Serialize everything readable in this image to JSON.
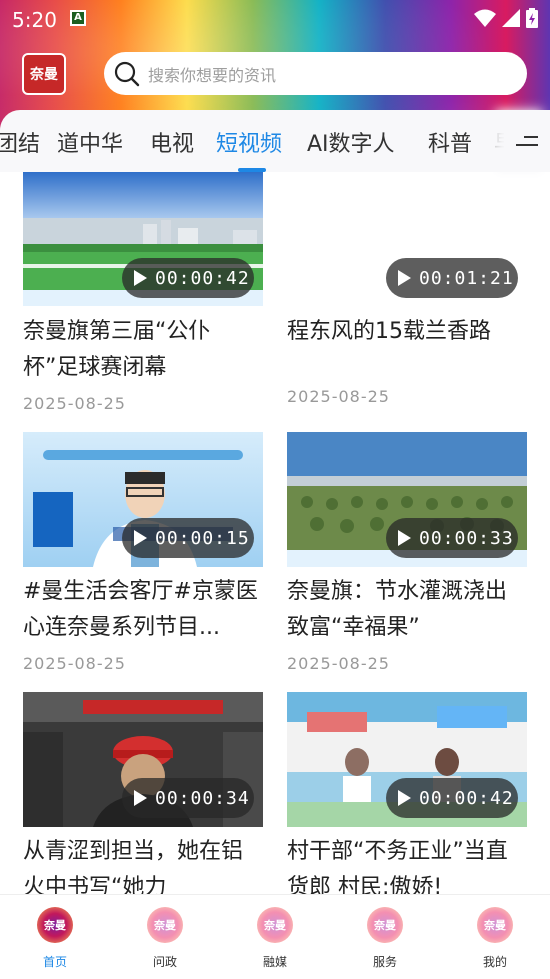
{
  "status_bar": {
    "time": "5:20",
    "notification_glyph": "A"
  },
  "header": {
    "logo_text": "奈曼",
    "search_placeholder": "搜索你想要的资讯"
  },
  "tabs": [
    {
      "label": "团结"
    },
    {
      "label": "道中华"
    },
    {
      "label": "电视"
    },
    {
      "label": "短视频",
      "active": true
    },
    {
      "label": "AI数字人"
    },
    {
      "label": "科普"
    },
    {
      "label": "早"
    }
  ],
  "videos": [
    {
      "title": "奈曼旗第三届“公仆杯”足球赛闭幕",
      "duration": "00:00:42",
      "date": "2025-08-25",
      "thumb_text": "奈曼旗第三届“公仆杯”足球赛闭幕"
    },
    {
      "title": "程东风的15载兰香路",
      "duration": "00:01:21",
      "date": "2025-08-25"
    },
    {
      "title": "#曼生活会客厅#京蒙医心连奈曼系列节目...",
      "duration": "00:00:15",
      "date": "2025-08-25",
      "thumb_text": "曼生活会客厅"
    },
    {
      "title": "奈曼旗：节水灌溉浇出致富“幸福果”",
      "duration": "00:00:33",
      "date": "2025-08-25",
      "thumb_text": "奈曼旗 节水灌溉浇出致富 “幸福果”"
    },
    {
      "title": "从青涩到担当，她在铝火中书写“她力",
      "duration": "00:00:34",
      "date": ""
    },
    {
      "title": "村干部“不务正业”当直货郎 村民:傲娇!",
      "duration": "00:00:42",
      "date": ""
    }
  ],
  "bottom_nav": [
    {
      "label": "首页",
      "active": true,
      "icon_text": "奈曼"
    },
    {
      "label": "问政",
      "icon_text": "奈曼"
    },
    {
      "label": "融媒",
      "icon_text": "奈曼"
    },
    {
      "label": "服务",
      "icon_text": "奈曼"
    },
    {
      "label": "我的",
      "icon_text": "奈曼"
    }
  ],
  "colors": {
    "accent": "#1e88e5",
    "logo_red": "#c62828"
  }
}
